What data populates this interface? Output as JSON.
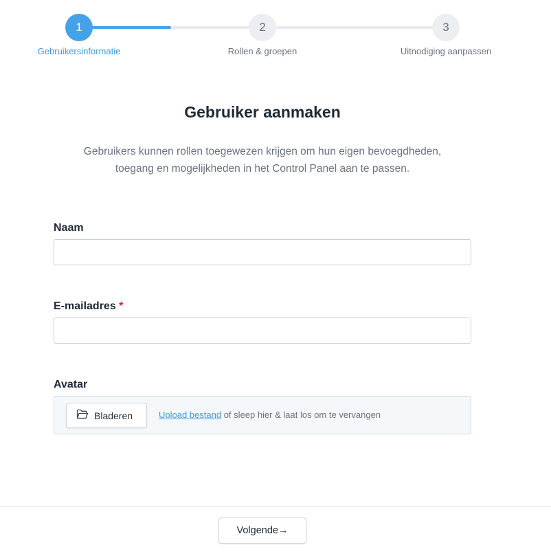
{
  "stepper": {
    "steps": [
      {
        "number": "1",
        "label": "Gebruikersinformatie",
        "active": true
      },
      {
        "number": "2",
        "label": "Rollen & groepen",
        "active": false
      },
      {
        "number": "3",
        "label": "Uitnodiging aanpassen",
        "active": false
      }
    ],
    "colors": {
      "active": "#45a2e9",
      "inactive": "#eceef1"
    }
  },
  "header": {
    "title": "Gebruiker aanmaken",
    "intro_line1": "Gebruikers kunnen rollen toegewezen krijgen om hun eigen bevoegdheden,",
    "intro_line2": "toegang en mogelijkheden in het Control Panel aan te passen."
  },
  "form": {
    "name": {
      "label": "Naam",
      "value": ""
    },
    "email": {
      "label": "E-mailadres",
      "required_mark": "*",
      "value": ""
    },
    "avatar": {
      "label": "Avatar",
      "browse_label": "Bladeren",
      "browse_icon": "folder-open-icon",
      "upload_link": "Upload bestand",
      "drop_hint": " of sleep hier & laat los om te vervangen"
    }
  },
  "footer": {
    "next_label": "Volgende",
    "next_icon": "→"
  }
}
